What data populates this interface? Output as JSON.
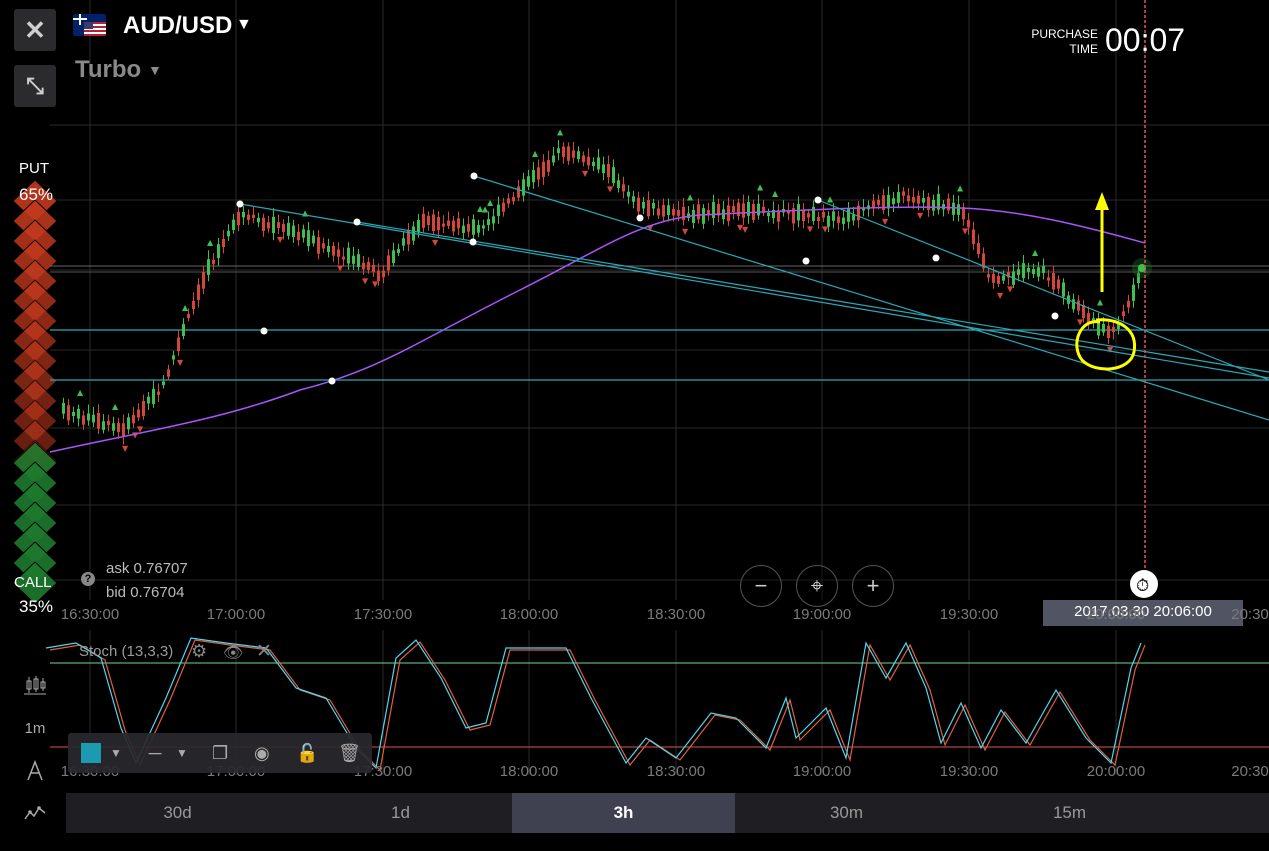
{
  "header": {
    "pair": "AUD/USD",
    "mode": "Turbo",
    "purchase_label_1": "PURCHASE",
    "purchase_label_2": "TIME",
    "purchase_timer": "00:07"
  },
  "sentiment": {
    "put_label": "PUT",
    "put_pct": "65%",
    "call_label": "CALL",
    "call_pct": "35%"
  },
  "quote": {
    "ask_label": "ask",
    "ask_value": "0.76707",
    "bid_label": "bid",
    "bid_value": "0.76704"
  },
  "expiry_time": "2017.03.30 20:06:00",
  "time_axis": [
    "16:30:00",
    "17:00:00",
    "17:30:00",
    "18:00:00",
    "18:30:00",
    "19:00:00",
    "19:30:00",
    "20:00:00",
    "20:30"
  ],
  "stochastic": {
    "label": "Stoch (13,3,3)"
  },
  "side_tools": {
    "interval": "1m"
  },
  "periods": [
    "30d",
    "1d",
    "3h",
    "30m",
    "15m"
  ],
  "active_period": "3h",
  "colors": {
    "put": "#c23a1e",
    "call": "#1e7a2e",
    "trend_line": "#2aa8b8",
    "moving_average": "#a855f7",
    "annotation": "#ffff00",
    "expiry_line": "#e05252",
    "stoch_k": "#4fd8f0",
    "stoch_d": "#e06040"
  },
  "chart_data": {
    "type": "line",
    "xlabel": "",
    "ylabel": "",
    "x": [
      "16:30",
      "17:00",
      "17:30",
      "18:00",
      "18:30",
      "19:00",
      "19:30",
      "20:00",
      "20:06"
    ],
    "series": [
      {
        "values": [
          0.7658,
          0.768,
          0.7678,
          0.769,
          0.7684,
          0.7683,
          0.7682,
          0.7668,
          0.7672
        ]
      }
    ]
  }
}
